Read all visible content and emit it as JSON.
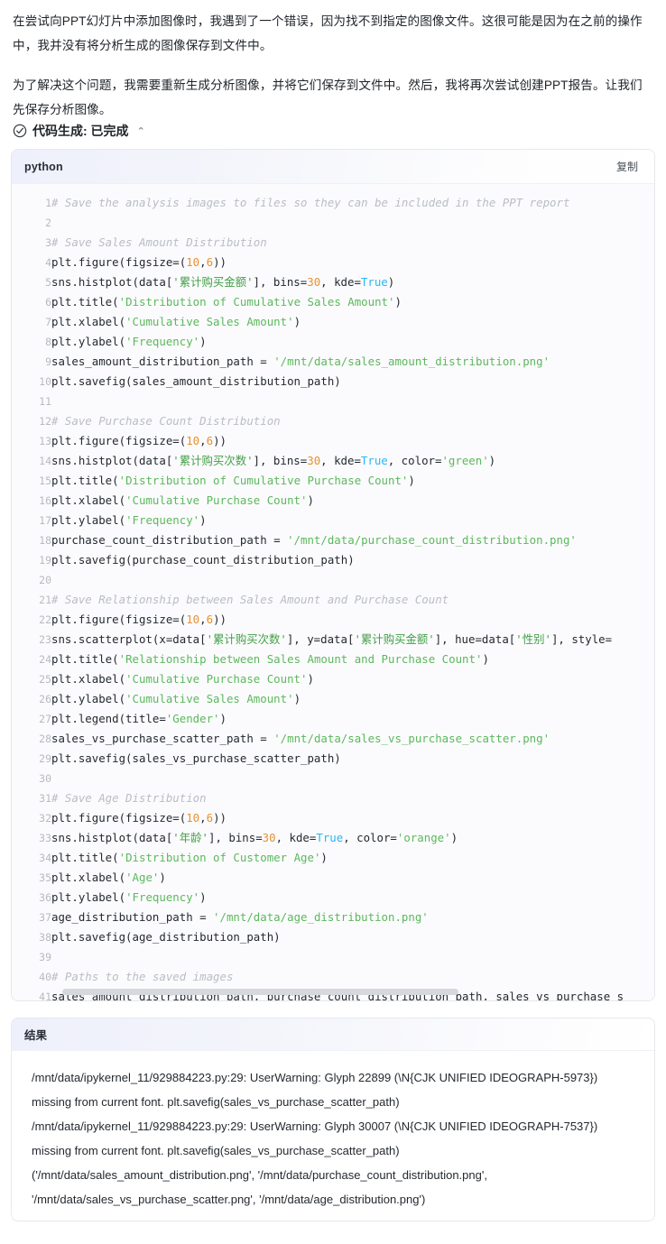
{
  "intro": {
    "paragraph_1": "在尝试向PPT幻灯片中添加图像时，我遇到了一个错误，因为找不到指定的图像文件。这很可能是因为在之前的操作中，我并没有将分析生成的图像保存到文件中。",
    "paragraph_2": "为了解决这个问题，我需要重新生成分析图像，并将它们保存到文件中。然后，我将再次尝试创建PPT报告。让我们先保存分析图像。"
  },
  "status": {
    "icon": "check-circle-icon",
    "label": "代码生成: 已完成",
    "chevron": "⌃",
    "chevron_icon": "chevron-up-icon"
  },
  "code_block": {
    "language": "python",
    "copy_label": "复制",
    "line_numbers": [
      1,
      2,
      3,
      4,
      5,
      6,
      7,
      8,
      9,
      10,
      11,
      12,
      13,
      14,
      15,
      16,
      17,
      18,
      19,
      20,
      21,
      22,
      23,
      24,
      25,
      26,
      27,
      28,
      29,
      30,
      31,
      32,
      33,
      34,
      35,
      36,
      37,
      38,
      39,
      40,
      41
    ],
    "lines": [
      "# Save the analysis images to files so they can be included in the PPT report",
      "",
      "# Save Sales Amount Distribution",
      "plt.figure(figsize=(10,6))",
      "sns.histplot(data['累计购买金额'], bins=30, kde=True)",
      "plt.title('Distribution of Cumulative Sales Amount')",
      "plt.xlabel('Cumulative Sales Amount')",
      "plt.ylabel('Frequency')",
      "sales_amount_distribution_path = '/mnt/data/sales_amount_distribution.png'",
      "plt.savefig(sales_amount_distribution_path)",
      "",
      "# Save Purchase Count Distribution",
      "plt.figure(figsize=(10,6))",
      "sns.histplot(data['累计购买次数'], bins=30, kde=True, color='green')",
      "plt.title('Distribution of Cumulative Purchase Count')",
      "plt.xlabel('Cumulative Purchase Count')",
      "plt.ylabel('Frequency')",
      "purchase_count_distribution_path = '/mnt/data/purchase_count_distribution.png'",
      "plt.savefig(purchase_count_distribution_path)",
      "",
      "# Save Relationship between Sales Amount and Purchase Count",
      "plt.figure(figsize=(10,6))",
      "sns.scatterplot(x=data['累计购买次数'], y=data['累计购买金额'], hue=data['性别'], style=",
      "plt.title('Relationship between Sales Amount and Purchase Count')",
      "plt.xlabel('Cumulative Purchase Count')",
      "plt.ylabel('Cumulative Sales Amount')",
      "plt.legend(title='Gender')",
      "sales_vs_purchase_scatter_path = '/mnt/data/sales_vs_purchase_scatter.png'",
      "plt.savefig(sales_vs_purchase_scatter_path)",
      "",
      "# Save Age Distribution",
      "plt.figure(figsize=(10,6))",
      "sns.histplot(data['年龄'], bins=30, kde=True, color='orange')",
      "plt.title('Distribution of Customer Age')",
      "plt.xlabel('Age')",
      "plt.ylabel('Frequency')",
      "age_distribution_path = '/mnt/data/age_distribution.png'",
      "plt.savefig(age_distribution_path)",
      "",
      "# Paths to the saved images",
      "sales_amount_distribution_path, purchase_count_distribution_path, sales_vs_purchase_s"
    ],
    "scrollbar": {
      "orientation": "horizontal",
      "thumb_fraction": 0.68
    }
  },
  "result_block": {
    "title": "结果",
    "output_lines": [
      "/mnt/data/ipykernel_11/929884223.py:29: UserWarning: Glyph 22899 (\\N{CJK UNIFIED IDEOGRAPH-5973}) missing from current font. plt.savefig(sales_vs_purchase_scatter_path)",
      "/mnt/data/ipykernel_11/929884223.py:29: UserWarning: Glyph 30007 (\\N{CJK UNIFIED IDEOGRAPH-7537}) missing from current font. plt.savefig(sales_vs_purchase_scatter_path)",
      "('/mnt/data/sales_amount_distribution.png', '/mnt/data/purchase_count_distribution.png', '/mnt/data/sales_vs_purchase_scatter.png', '/mnt/data/age_distribution.png')"
    ]
  },
  "colors": {
    "page_background": "#ffffff",
    "text": "#24292f",
    "code_comment": "#b9bdc4",
    "code_string": "#5cb85c",
    "code_number": "#e8912d",
    "code_keyword": "#29b6f6",
    "card_border": "#e6e8ec",
    "header_gradient_start": "#eef0fb",
    "scrollbar_thumb": "#d6d8dd"
  }
}
